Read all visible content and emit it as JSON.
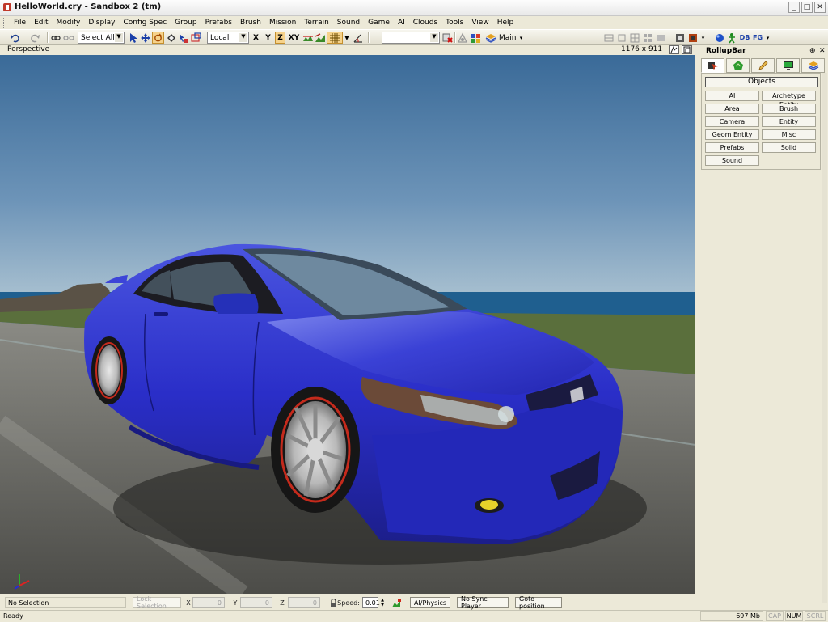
{
  "window": {
    "title": "HelloWorld.cry - Sandbox 2 (tm)",
    "buttons": {
      "minimize": "_",
      "maximize": "□",
      "close": "✕"
    }
  },
  "menu": [
    "File",
    "Edit",
    "Modify",
    "Display",
    "Config Spec",
    "Group",
    "Prefabs",
    "Brush",
    "Mission",
    "Terrain",
    "Sound",
    "Game",
    "AI",
    "Clouds",
    "Tools",
    "View",
    "Help"
  ],
  "toolbar": {
    "selection_filter": "Select All",
    "ref_coord": "Local",
    "axes": [
      "X",
      "Y",
      "Z",
      "XY"
    ],
    "active_axis": "Z",
    "layer_label": "Main",
    "db_label": "DB",
    "fg_label": "FG"
  },
  "viewport": {
    "name": "Perspective",
    "resolution": "1176 x 911"
  },
  "rollup": {
    "title": "RollupBar",
    "pin": "⊕",
    "close": "✕",
    "objects_label": "Objects",
    "buttons": [
      "AI",
      "Archetype Entity",
      "Area",
      "Brush",
      "Camera",
      "Entity",
      "Geom Entity",
      "Misc",
      "Prefabs",
      "Solid",
      "Sound"
    ]
  },
  "bottom": {
    "selection_status": "No Selection",
    "lock_selection": "Lock Selection",
    "x_label": "X",
    "x_value": "0",
    "y_label": "Y",
    "y_value": "0",
    "z_label": "Z",
    "z_value": "0",
    "speed_label": "Speed:",
    "speed_value": "0.01",
    "ai_physics": "AI/Physics",
    "sync_player": "No Sync Player",
    "goto_position": "Goto position"
  },
  "status": {
    "text": "Ready",
    "memory": "697 Mb",
    "cap": "CAP",
    "num": "NUM",
    "scrl": "SCRL"
  },
  "colors": {
    "car_body": "#2a2ec8",
    "sky_top": "#3a6a98",
    "sky_bottom": "#9fb8c8",
    "ocean": "#1f5f8f",
    "grass": "#5a6f3c",
    "road": "#6d6d68"
  }
}
